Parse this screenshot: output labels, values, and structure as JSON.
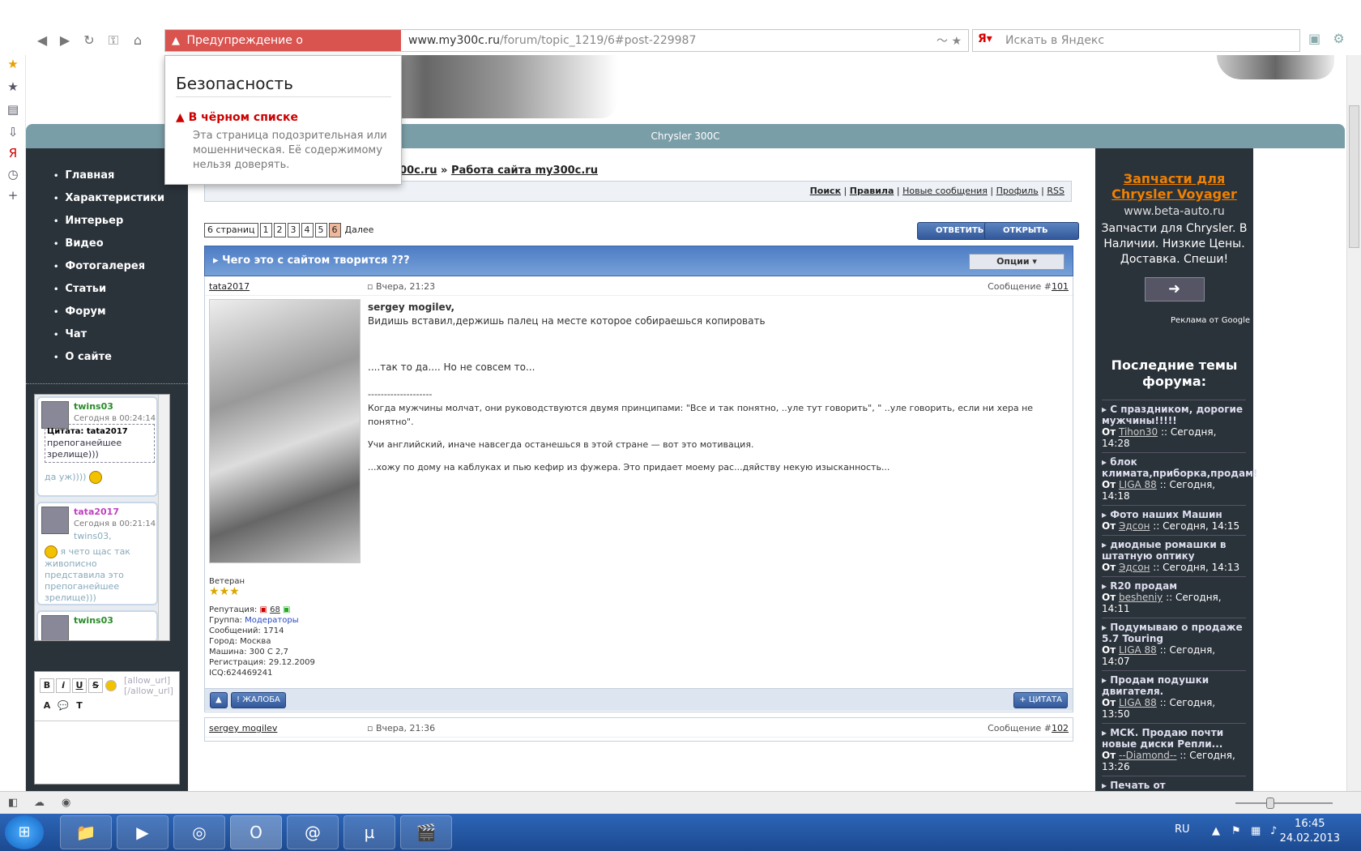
{
  "browser": {
    "warning_chip": "Предупреждение о мошенничестве",
    "url_host": "www.my300c.ru",
    "url_path": "/forum/topic_1219/6#post-229987",
    "search_placeholder": "Искать в Яндекс"
  },
  "security_popup": {
    "title": "Безопасность",
    "warning": "В чёрном списке",
    "description": "Эта страница подозрительная или мошенническая. Её содержимому нельзя доверять."
  },
  "site": {
    "banner_title": "Chrysler 300C",
    "menu": [
      "Главная",
      "Характеристики",
      "Интерьер",
      "Видео",
      "Фотогалерея",
      "Статьи",
      "Форум",
      "Чат",
      "О сайте"
    ]
  },
  "breadcrumb": {
    "part1": "my300c.ru",
    "sep": "»",
    "part2": "Работа сайта my300c.ru"
  },
  "toplinks": {
    "search": "Поиск",
    "rules": "Правила",
    "new": "Новые сообщения",
    "profile": "Профиль",
    "rss": "RSS"
  },
  "pager": {
    "label": "6 страниц",
    "pages": [
      "1",
      "2",
      "3",
      "4",
      "5",
      "6"
    ],
    "next": "Далее"
  },
  "buttons": {
    "reply": "ОТВЕТИТЬ",
    "new_topic": "ОТКРЫТЬ ТЕМУ",
    "options": "Опции ▾",
    "complaint": "ЖАЛОБА",
    "quote": "ЦИТАТА"
  },
  "topic": {
    "title": "Чего это с сайтом творится ???"
  },
  "post": {
    "author": "tata2017",
    "date": "Вчера, 21:23",
    "number_prefix": "Сообщение #",
    "number": "101",
    "addressee": "sergey mogilev,",
    "line1": "Видишь вставил,держишь палец на месте которое собираешься копировать",
    "line2": "....так то да.... Но не совсем то...",
    "sig_sep": "--------------------",
    "sig1": "Когда мужчины молчат, они руководствуются двумя принципами: \"Все и так понятно, ..уле тут говорить\", \" ..уле говорить, если ни хера не понятно\".",
    "sig2": "Учи английский, иначе навсегда останешься в этой стране — вот это мотивация.",
    "sig3": "...хожу по дому на каблуках и пью кефир из фужера. Это придает моему рас...дяйству некую изысканность...",
    "rank": "Ветеран",
    "reputation_label": "Репутация:",
    "reputation": "68",
    "group_label": "Группа:",
    "group": "Модераторы",
    "messages": "Сообщений: 1714",
    "city": "Город: Москва",
    "car": "Машина: 300 C 2,7",
    "registered": "Регистрация: 29.12.2009",
    "icq": "ICQ:624469241"
  },
  "next_post": {
    "author": "sergey mogilev",
    "date": "Вчера, 21:36",
    "number_prefix": "Сообщение #",
    "number": "102"
  },
  "shoutbox": [
    {
      "name": "twins03",
      "time": "Сегодня в 00:24:14",
      "quote": "Цитата: tata2017",
      "text": "препоганейшее зрелище)))",
      "text2": "да уж))))"
    },
    {
      "name": "tata2017",
      "time": "Сегодня в 00:21:14",
      "text": "twins03,",
      "text2": "я чето щас так живописно представила это препоганейшее зрелище)))"
    },
    {
      "name": "twins03"
    }
  ],
  "editor": {
    "hint": "[allow_url] [/allow_url]"
  },
  "ad": {
    "title": "Запчасти для Chrysler Voyager",
    "url": "www.beta-auto.ru",
    "desc": "Запчасти для Chrysler. В Наличии. Низкие Цены. Доставка. Спеши!",
    "by": "Реклама от Google"
  },
  "forum": {
    "title": "Последние темы форума:",
    "topics": [
      {
        "title": "С праздником, дорогие мужчины!!!!!",
        "by": "Tihon30",
        "when": ":: Сегодня, 14:28"
      },
      {
        "title": "блок климата,приборка,продам!",
        "by": "LIGA 88",
        "when": ":: Сегодня, 14:18"
      },
      {
        "title": "Фото наших Машин",
        "by": "Эдсон",
        "when": ":: Сегодня, 14:15"
      },
      {
        "title": "диодные ромашки в штатную оптику",
        "by": "Эдсон",
        "when": ":: Сегодня, 14:13"
      },
      {
        "title": "R20 продам",
        "by": "besheniy",
        "when": ":: Сегодня, 14:11"
      },
      {
        "title": "Подумываю о продаже 5.7 Touring",
        "by": "LIGA 88",
        "when": ":: Сегодня, 14:07"
      },
      {
        "title": "Продам подушки двигателя.",
        "by": "LIGA 88",
        "when": ":: Сегодня, 13:50"
      },
      {
        "title": "МСК. Продаю почти новые диски Репли...",
        "by": "--Diamond--",
        "when": ":: Сегодня, 13:26"
      },
      {
        "title": "Печать от",
        "by": "",
        "when": ""
      }
    ],
    "from_label": "От"
  },
  "taskbar": {
    "lang": "RU",
    "time": "16:45",
    "date": "24.02.2013"
  }
}
